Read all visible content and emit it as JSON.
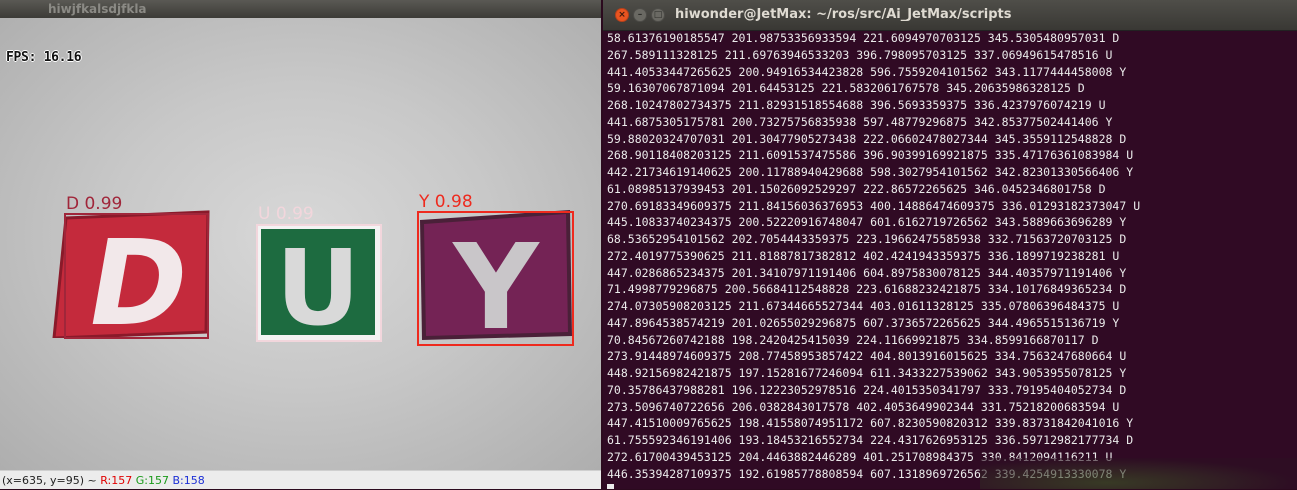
{
  "cv_window": {
    "title": "hiwjfkalsdjfkla",
    "fps": "FPS: 16.16",
    "statusbar": {
      "coords": "(x=635, y=95) ~ ",
      "r": "R:157",
      "g": "G:157",
      "b": "B:158"
    },
    "colors": {
      "r": "#e00000",
      "g": "#1a9a1a",
      "b": "#1c2fd6"
    },
    "detections": [
      {
        "letter": "D",
        "label": "D 0.99",
        "card_color": "#c42a3c",
        "box_color": "#a0263a",
        "text_color": "#a0263a"
      },
      {
        "letter": "U",
        "label": "U 0.99",
        "card_color": "#1d6b40",
        "box_color": "#f2d6dc",
        "text_color": "#f2d6dc"
      },
      {
        "letter": "Y",
        "label": "Y 0.98",
        "card_color": "#742355",
        "box_color": "#ee2a1e",
        "text_color": "#ee2a1e"
      }
    ]
  },
  "terminal": {
    "title": "hiwonder@JetMax: ~/ros/src/Ai_JetMax/scripts",
    "buttons": {
      "close": "×",
      "minimize": "–",
      "maximize": "□"
    },
    "lines": [
      "58.61376190185547 201.98753356933594 221.6094970703125 345.5305480957031 D",
      "267.589111328125 211.69763946533203 396.798095703125 337.06949615478516 U",
      "441.40533447265625 200.94916534423828 596.7559204101562 343.1177444458008 Y",
      "59.16307067871094 201.64453125 221.5832061767578 345.20635986328125 D",
      "268.10247802734375 211.82931518554688 396.5693359375 336.4237976074219 U",
      "441.6875305175781 200.73275756835938 597.48779296875 342.85377502441406 Y",
      "59.88020324707031 201.30477905273438 222.06602478027344 345.3559112548828 D",
      "268.90118408203125 211.6091537475586 396.90399169921875 335.47176361083984 U",
      "442.21734619140625 200.11788940429688 598.3027954101562 342.82301330566406 Y",
      "61.08985137939453 201.15026092529297 222.86572265625 346.0452346801758 D",
      "270.69183349609375 211.84156036376953 400.14886474609375 336.01293182373047 U",
      "445.10833740234375 200.52220916748047 601.6162719726562 343.5889663696289 Y",
      "68.53652954101562 202.7054443359375 223.19662475585938 332.71563720703125 D",
      "272.4019775390625 211.81887817382812 402.4241943359375 336.1899719238281 U",
      "447.0286865234375 201.34107971191406 604.8975830078125 344.40357971191406 Y",
      "71.4998779296875 200.56684112548828 223.61688232421875 334.10176849365234 D",
      "274.07305908203125 211.67344665527344 403.01611328125 335.07806396484375 U",
      "447.8964538574219 201.02655029296875 607.3736572265625 344.4965515136719 Y",
      "70.84567260742188 198.2420425415039 224.11669921875 334.8599166870117 D",
      "273.91448974609375 208.77458953857422 404.8013916015625 334.7563247680664 U",
      "448.92156982421875 197.15281677246094 611.3433227539062 343.9053955078125 Y",
      "70.35786437988281 196.12223052978516 224.4015350341797 333.79195404052734 D",
      "273.5096740722656 206.0382843017578 402.4053649902344 331.75218200683594 U",
      "447.41510009765625 198.41558074951172 607.8230590820312 339.83731842041016 Y",
      "61.755592346191406 193.18453216552734 224.4317626953125 336.59712982177734 D",
      "272.61700439453125 204.4463882446289 401.251708984375 330.8412094116211 U",
      "446.35394287109375 192.61985778808594 607.1318969726562 339.4254913330078 Y"
    ]
  }
}
